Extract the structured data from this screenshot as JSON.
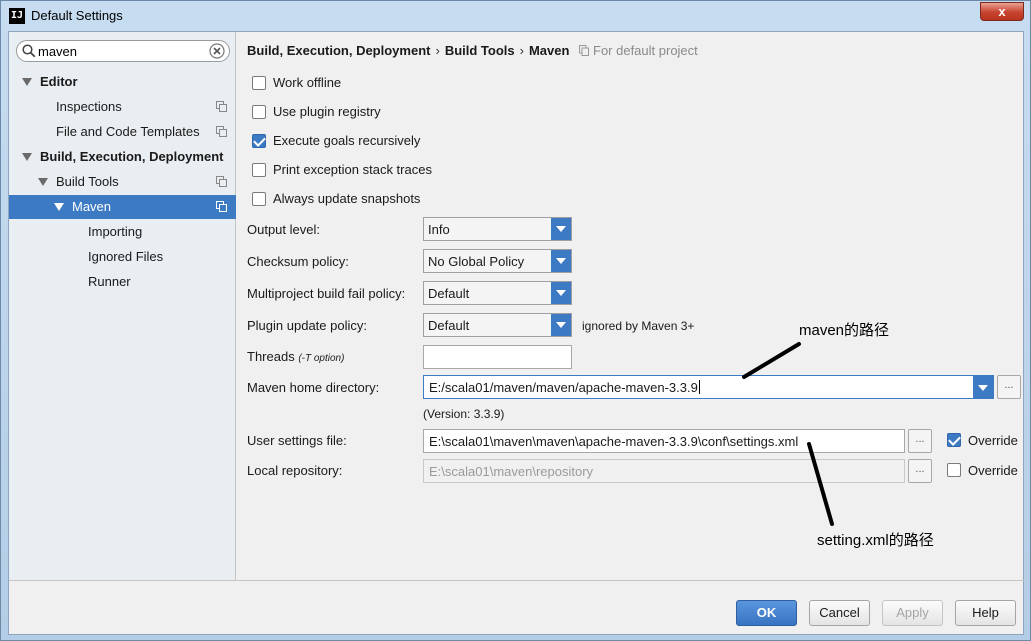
{
  "window": {
    "title": "Default Settings",
    "app_icon_label": "IJ",
    "close_label": "x"
  },
  "search": {
    "value": "maven"
  },
  "tree": [
    {
      "label": "Editor",
      "bold": true,
      "arrow": true,
      "copy": false
    },
    {
      "label": "Inspections",
      "bold": false,
      "arrow": false,
      "copy": true
    },
    {
      "label": "File and Code Templates",
      "bold": false,
      "arrow": false,
      "copy": true
    },
    {
      "label": "Build, Execution, Deployment",
      "bold": true,
      "arrow": true,
      "copy": false
    },
    {
      "label": "Build Tools",
      "bold": false,
      "arrow": true,
      "copy": true
    },
    {
      "label": "Maven",
      "bold": false,
      "arrow": true,
      "copy": true,
      "selected": true
    },
    {
      "label": "Importing",
      "bold": false,
      "arrow": false,
      "copy": false
    },
    {
      "label": "Ignored Files",
      "bold": false,
      "arrow": false,
      "copy": false
    },
    {
      "label": "Runner",
      "bold": false,
      "arrow": false,
      "copy": false
    }
  ],
  "breadcrumb": {
    "items": [
      "Build, Execution, Deployment",
      "Build Tools",
      "Maven"
    ],
    "separator": "›",
    "hint": "For default project"
  },
  "options": [
    {
      "label": "Work offline",
      "checked": false
    },
    {
      "label": "Use plugin registry",
      "checked": false
    },
    {
      "label": "Execute goals recursively",
      "checked": true
    },
    {
      "label": "Print exception stack traces",
      "checked": false
    },
    {
      "label": "Always update snapshots",
      "checked": false
    }
  ],
  "settings": {
    "output_level": {
      "label": "Output level:",
      "value": "Info"
    },
    "checksum_policy": {
      "label": "Checksum policy:",
      "value": "No Global Policy"
    },
    "multiproject_policy": {
      "label": "Multiproject build fail policy:",
      "value": "Default"
    },
    "plugin_update_policy": {
      "label": "Plugin update policy:",
      "value": "Default",
      "note": "ignored by Maven 3+"
    },
    "threads": {
      "label": "Threads",
      "hint": "(-T option)",
      "value": ""
    },
    "maven_home": {
      "label": "Maven home directory:",
      "value": "E:/scala01/maven/maven/apache-maven-3.3.9",
      "version": "(Version: 3.3.9)"
    },
    "user_settings": {
      "label": "User settings file:",
      "value": "E:\\scala01\\maven\\maven\\apache-maven-3.3.9\\conf\\settings.xml",
      "override_label": "Override",
      "override_checked": true
    },
    "local_repo": {
      "label": "Local repository:",
      "value": "E:\\scala01\\maven\\repository",
      "override_label": "Override",
      "override_checked": false
    },
    "browse_label": "..."
  },
  "annotations": {
    "maven_path": "maven的路径",
    "settings_path": "setting.xml的路径"
  },
  "buttons": {
    "ok": "OK",
    "cancel": "Cancel",
    "apply": "Apply",
    "help": "Help"
  },
  "colors": {
    "accent": "#3d7ac4",
    "selection": "#3d7ac4"
  }
}
